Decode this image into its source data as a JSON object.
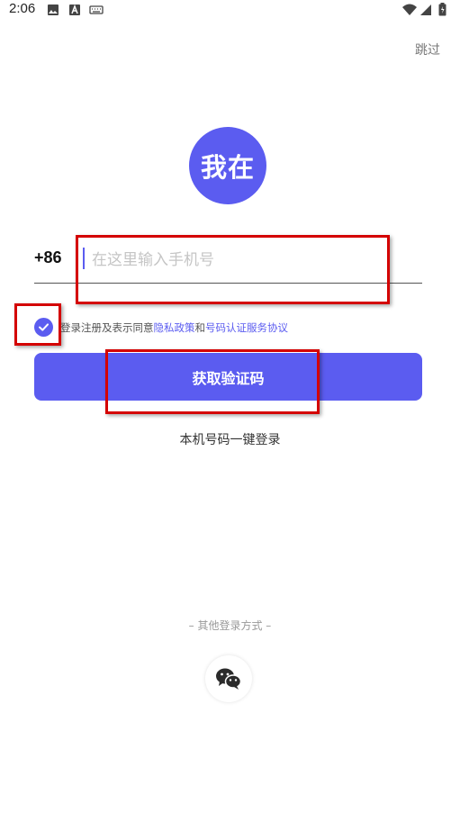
{
  "status_bar": {
    "time": "2:06"
  },
  "header": {
    "skip_label": "跳过"
  },
  "logo": {
    "text": "我在",
    "accent": "#5b5cf0"
  },
  "phone": {
    "country_code": "+86",
    "placeholder": "在这里输入手机号",
    "value": ""
  },
  "agreement": {
    "checked": true,
    "prefix": "登录注册及表示同意",
    "privacy_link": "隐私政策",
    "joiner": "和",
    "service_link": "号码认证服务协议"
  },
  "actions": {
    "get_code_label": "获取验证码",
    "one_tap_label": "本机号码一键登录",
    "other_methods_label": "– 其他登录方式 –"
  },
  "icons": {
    "wechat": "wechat-icon",
    "check": "check-icon",
    "wifi": "wifi-icon",
    "signal": "signal-icon",
    "battery": "battery-icon"
  },
  "annotation_color": "#d40000"
}
